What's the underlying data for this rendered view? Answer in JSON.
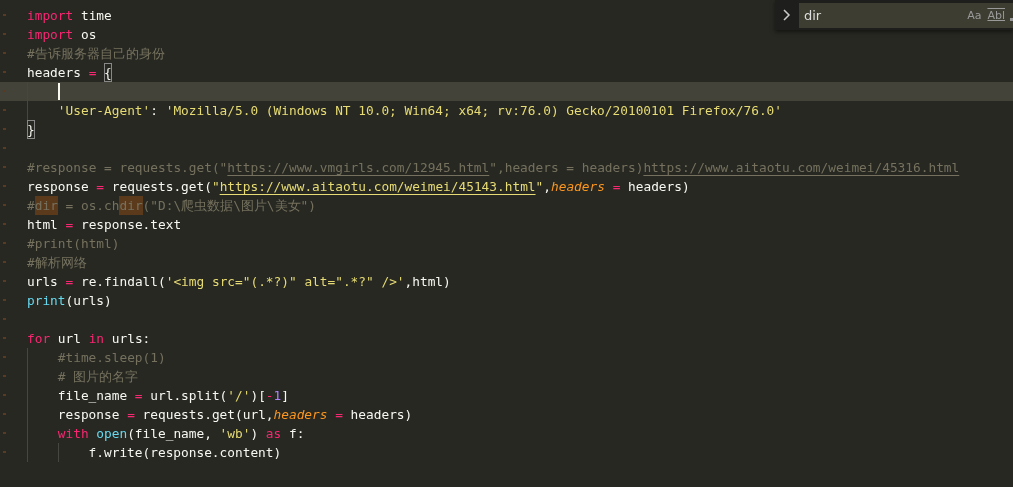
{
  "find_panel": {
    "query": "dir",
    "options": [
      {
        "label": "Aa",
        "kind": "case",
        "on": false
      },
      {
        "label": "Abl",
        "kind": "word",
        "on": false
      }
    ]
  },
  "lines": [
    {
      "current": false,
      "tokens": [
        {
          "text": "import",
          "kind": "keyword"
        },
        {
          "text": " time",
          "kind": "plain"
        }
      ]
    },
    {
      "current": false,
      "tokens": [
        {
          "text": "import",
          "kind": "keyword"
        },
        {
          "text": " os",
          "kind": "plain"
        }
      ]
    },
    {
      "current": false,
      "tokens": [
        {
          "text": "#告诉服务器自己的身份",
          "kind": "comment"
        }
      ]
    },
    {
      "current": false,
      "tokens": [
        {
          "text": "headers ",
          "kind": "plain"
        },
        {
          "text": "= ",
          "kind": "operator"
        },
        {
          "text": "{",
          "kind": "bracket"
        }
      ]
    },
    {
      "current": true
    },
    {
      "current": false,
      "tokens": [
        {
          "text": "    'User-Agent'",
          "kind": "string"
        },
        {
          "text": ": ",
          "kind": "plain"
        },
        {
          "text": "'Mozilla/5.0 (Windows NT 10.0; Win64; x64; rv:76.0) Gecko/20100101 Firefox/76.0'",
          "kind": "string"
        }
      ]
    },
    {
      "current": false,
      "tokens": [
        {
          "text": "}",
          "kind": "bracket"
        }
      ]
    },
    {
      "current": false
    },
    {
      "current": false,
      "tokens": [
        {
          "text": "#response = requests.get(\"",
          "kind": "comment"
        },
        {
          "text": "https://www.vmgirls.com/12945.html",
          "kind": "comment-link"
        },
        {
          "text": "\",headers = headers)",
          "kind": "comment"
        },
        {
          "text": "https://www.aitaotu.com/weimei/45316.html",
          "kind": "comment-link"
        }
      ]
    },
    {
      "current": false,
      "tokens": [
        {
          "text": "response ",
          "kind": "plain"
        },
        {
          "text": "=",
          "kind": "operator"
        },
        {
          "text": " requests.get(",
          "kind": "plain"
        },
        {
          "text": "\"",
          "kind": "string"
        },
        {
          "text": "https://www.aitaotu.com/weimei/45143.html",
          "kind": "string-link"
        },
        {
          "text": "\"",
          "kind": "string"
        },
        {
          "text": ",",
          "kind": "plain"
        },
        {
          "text": "headers",
          "kind": "param"
        },
        {
          "text": " = ",
          "kind": "operator"
        },
        {
          "text": "headers)",
          "kind": "plain"
        }
      ]
    },
    {
      "current": false,
      "tokens": [
        {
          "text": "#",
          "kind": "comment"
        },
        {
          "text": "dir",
          "kind": "match"
        },
        {
          "text": " = os.ch",
          "kind": "comment"
        },
        {
          "text": "dir",
          "kind": "match"
        },
        {
          "text": "(\"D:\\爬虫数据\\图片\\美女\")",
          "kind": "comment"
        }
      ]
    },
    {
      "current": false,
      "tokens": [
        {
          "text": "html ",
          "kind": "plain"
        },
        {
          "text": "=",
          "kind": "operator"
        },
        {
          "text": " response.text",
          "kind": "plain"
        }
      ]
    },
    {
      "current": false,
      "tokens": [
        {
          "text": "#print(html)",
          "kind": "comment"
        }
      ]
    },
    {
      "current": false,
      "tokens": [
        {
          "text": "#解析网络",
          "kind": "comment"
        }
      ]
    },
    {
      "current": false,
      "tokens": [
        {
          "text": "urls ",
          "kind": "plain"
        },
        {
          "text": "=",
          "kind": "operator"
        },
        {
          "text": " re.findall(",
          "kind": "plain"
        },
        {
          "text": "'<img src=\"(.*?)\" alt=\".*?\" />'",
          "kind": "string"
        },
        {
          "text": ",html)",
          "kind": "plain"
        }
      ]
    },
    {
      "current": false,
      "tokens": [
        {
          "text": "print",
          "kind": "builtin"
        },
        {
          "text": "(urls)",
          "kind": "plain"
        }
      ]
    },
    {
      "current": false
    },
    {
      "current": false,
      "tokens": [
        {
          "text": "for",
          "kind": "keyword"
        },
        {
          "text": " url ",
          "kind": "plain"
        },
        {
          "text": "in",
          "kind": "keyword"
        },
        {
          "text": " urls:",
          "kind": "plain"
        }
      ]
    },
    {
      "current": false,
      "tokens": [
        {
          "text": "    #time.sleep(1)",
          "kind": "comment"
        }
      ]
    },
    {
      "current": false,
      "tokens": [
        {
          "text": "    # 图片的名字",
          "kind": "comment"
        }
      ]
    },
    {
      "current": false,
      "tokens": [
        {
          "text": "    file_name ",
          "kind": "plain"
        },
        {
          "text": "=",
          "kind": "operator"
        },
        {
          "text": " url.split(",
          "kind": "plain"
        },
        {
          "text": "'/'",
          "kind": "string"
        },
        {
          "text": ")[",
          "kind": "plain"
        },
        {
          "text": "-",
          "kind": "operator"
        },
        {
          "text": "1",
          "kind": "number"
        },
        {
          "text": "]",
          "kind": "plain"
        }
      ]
    },
    {
      "current": false,
      "tokens": [
        {
          "text": "    response ",
          "kind": "plain"
        },
        {
          "text": "=",
          "kind": "operator"
        },
        {
          "text": " requests.get(url,",
          "kind": "plain"
        },
        {
          "text": "headers",
          "kind": "param"
        },
        {
          "text": " = ",
          "kind": "operator"
        },
        {
          "text": "headers)",
          "kind": "plain"
        }
      ]
    },
    {
      "current": false,
      "tokens": [
        {
          "text": "    with ",
          "kind": "keyword"
        },
        {
          "text": "open",
          "kind": "builtin"
        },
        {
          "text": "(file_name, ",
          "kind": "plain"
        },
        {
          "text": "'wb'",
          "kind": "string"
        },
        {
          "text": ") ",
          "kind": "plain"
        },
        {
          "text": "as",
          "kind": "keyword"
        },
        {
          "text": " f:",
          "kind": "plain"
        }
      ]
    },
    {
      "current": false,
      "tokens": [
        {
          "text": "        f.write(response.content)",
          "kind": "plain"
        }
      ]
    }
  ]
}
